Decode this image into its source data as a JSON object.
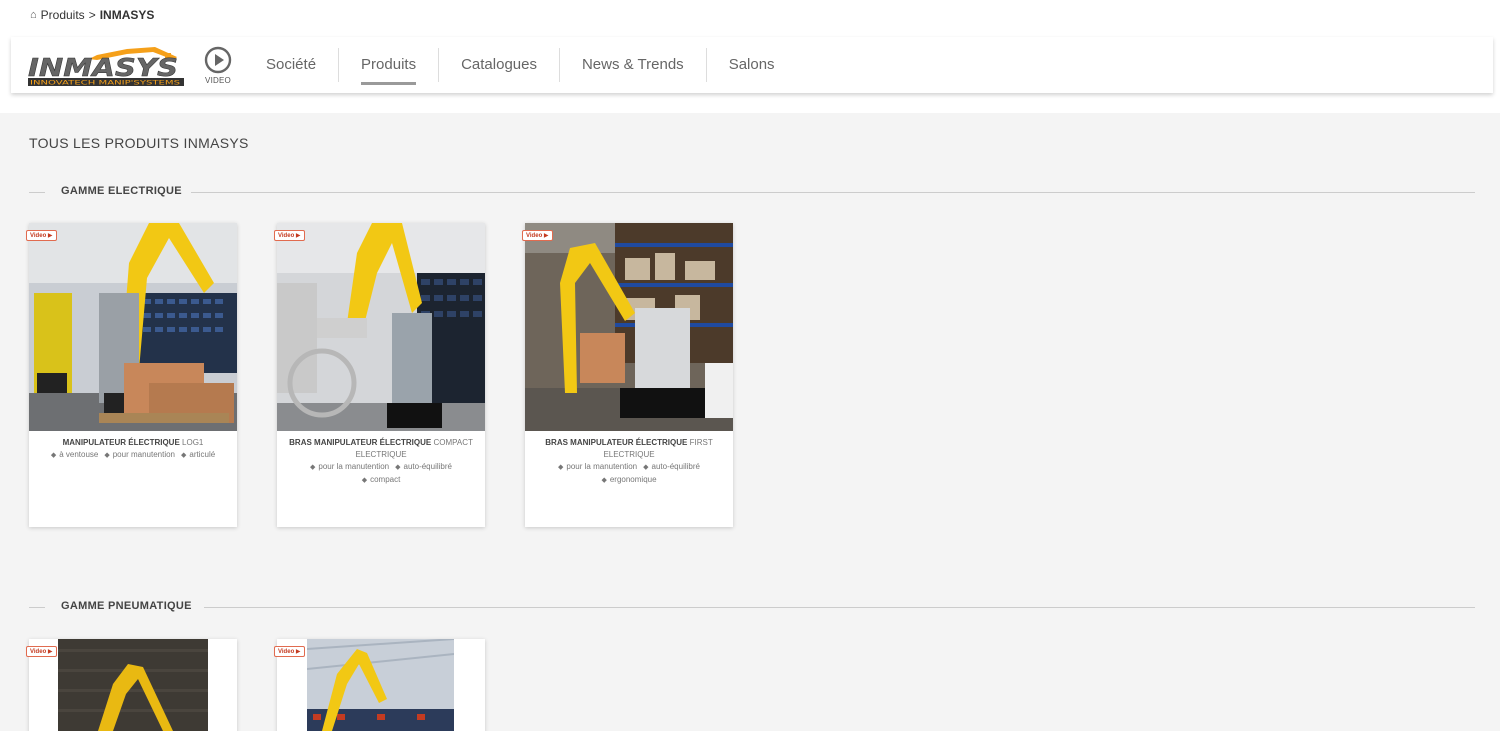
{
  "breadcrumb": {
    "home_icon": "home-icon",
    "parent": "Produits",
    "separator": ">",
    "current": "INMASYS"
  },
  "brand": {
    "name": "INMASYS",
    "tagline": "INNOVATECH MANIP'SYSTEMS",
    "accent": "#f5a01a"
  },
  "video_link": {
    "label": "VIDEO",
    "icon": "play-circle-icon"
  },
  "nav": {
    "items": [
      {
        "label": "Société",
        "active": false
      },
      {
        "label": "Produits",
        "active": true
      },
      {
        "label": "Catalogues",
        "active": false
      },
      {
        "label": "News & Trends",
        "active": false
      },
      {
        "label": "Salons",
        "active": false
      }
    ]
  },
  "page": {
    "title": "TOUS LES PRODUITS INMASYS"
  },
  "sections": [
    {
      "label": "GAMME ELECTRIQUE",
      "products": [
        {
          "badge": "Video",
          "title": "MANIPULATEUR ÉLECTRIQUE",
          "model": "LOG1",
          "tags": [
            "à ventouse",
            "pour manutention",
            "articulé"
          ]
        },
        {
          "badge": "Video",
          "title": "BRAS MANIPULATEUR ÉLECTRIQUE",
          "model": "COMPACT ELECTRIQUE",
          "tags": [
            "pour la manutention",
            "auto-équilibré",
            "compact"
          ]
        },
        {
          "badge": "Video",
          "title": "BRAS MANIPULATEUR ÉLECTRIQUE",
          "model": "FIRST ELECTRIQUE",
          "tags": [
            "pour la manutention",
            "auto-équilibré",
            "ergonomique"
          ]
        }
      ]
    },
    {
      "label": "GAMME PNEUMATIQUE",
      "products": [
        {
          "badge": "Video"
        },
        {
          "badge": "Video"
        }
      ]
    }
  ]
}
